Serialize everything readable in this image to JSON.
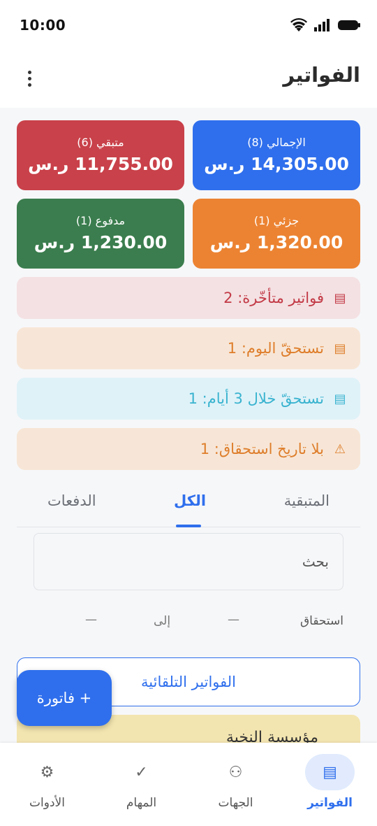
{
  "status_bar": {
    "time": "10:00"
  },
  "header": {
    "title": "الفواتير",
    "menu_icon": "more-vert-icon"
  },
  "summary": {
    "total": {
      "label": "الإجمالي (8)",
      "value": "14,305.00 ر.س",
      "color": "#2f6fed"
    },
    "remaining": {
      "label": "متبقي (6)",
      "value": "11,755.00 ر.س",
      "color": "#c9414a"
    },
    "partial": {
      "label": "جزئي (1)",
      "value": "1,320.00 ر.س",
      "color": "#ec8332"
    },
    "paid": {
      "label": "مدفوع (1)",
      "value": "1,230.00 ر.س",
      "color": "#3b7d4e"
    }
  },
  "alerts": {
    "overdue": {
      "icon": "▤",
      "text": "فواتير متأخّرة: 2"
    },
    "today": {
      "icon": "▤",
      "text": "تستحقّ اليوم: 1"
    },
    "three_days": {
      "icon": "▤",
      "text": "تستحقّ خلال 3 أيام: 1"
    },
    "no_date": {
      "icon": "⚠",
      "text": "بلا تاريخ استحقاق: 1"
    }
  },
  "tabs": {
    "remaining": "المتبقية",
    "all": "الكل",
    "payments": "الدفعات",
    "active": "all"
  },
  "search": {
    "placeholder": "بحث"
  },
  "filter": {
    "label": "استحقاق",
    "from": "—",
    "to_label": "إلى",
    "to": "—"
  },
  "auto_invoices_button": "الفواتير التلقائية",
  "list": {
    "first_item_title": "مؤسسة النخبة"
  },
  "fab": {
    "label": "+ فاتورة"
  },
  "bottom_nav": {
    "invoices": {
      "label": "الفواتير",
      "icon": "▤"
    },
    "contacts": {
      "label": "الجهات",
      "icon": "⚇"
    },
    "tasks": {
      "label": "المهام",
      "icon": "✓"
    },
    "tools": {
      "label": "الأدوات",
      "icon": "⚙"
    }
  }
}
